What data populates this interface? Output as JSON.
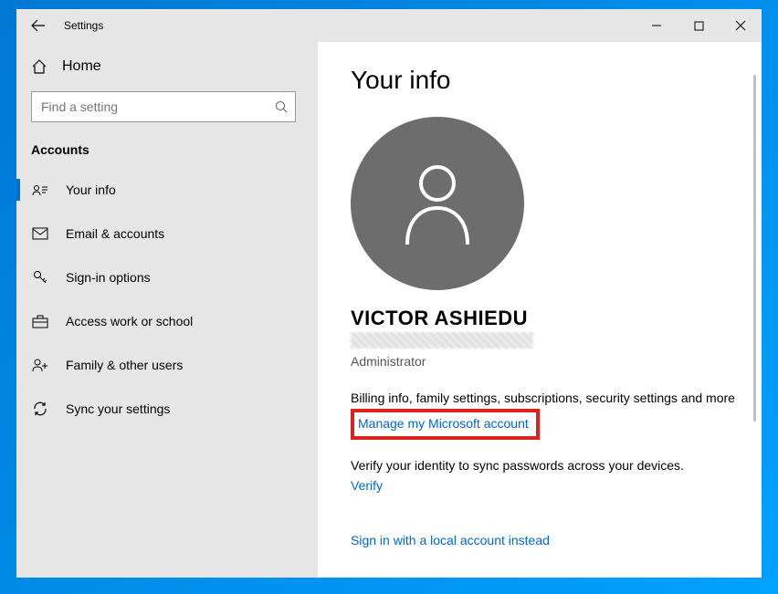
{
  "app_title": "Settings",
  "sidebar": {
    "home_label": "Home",
    "search_placeholder": "Find a setting",
    "section_label": "Accounts",
    "items": [
      {
        "icon": "user-card-icon",
        "label": "Your info",
        "active": true
      },
      {
        "icon": "mail-icon",
        "label": "Email & accounts",
        "active": false
      },
      {
        "icon": "key-icon",
        "label": "Sign-in options",
        "active": false
      },
      {
        "icon": "briefcase-icon",
        "label": "Access work or school",
        "active": false
      },
      {
        "icon": "family-icon",
        "label": "Family & other users",
        "active": false
      },
      {
        "icon": "sync-icon",
        "label": "Sync your settings",
        "active": false
      }
    ]
  },
  "main": {
    "title": "Your info",
    "user_name": "VICTOR ASHIEDU",
    "role": "Administrator",
    "billing_text": "Billing info, family settings, subscriptions, security settings and more",
    "manage_link": "Manage my Microsoft account",
    "verify_text": "Verify your identity to sync passwords across your devices.",
    "verify_link": "Verify",
    "local_signin_link": "Sign in with a local account instead"
  }
}
